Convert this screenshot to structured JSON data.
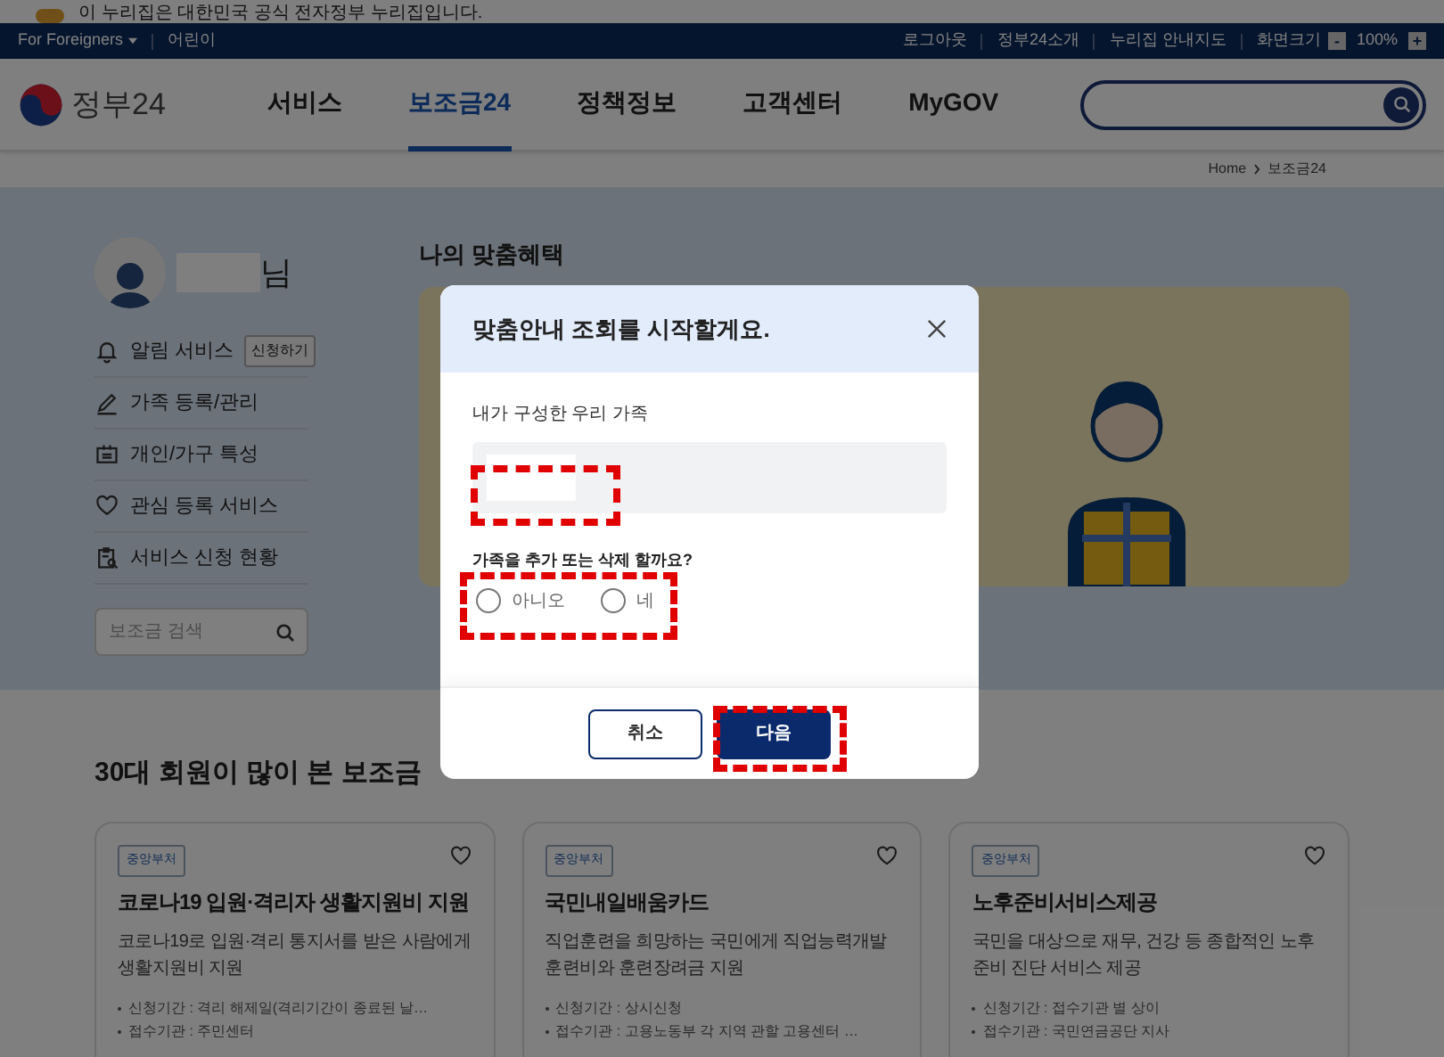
{
  "top_notice": "이 누리집은 대한민국 공식 전자정부 누리집입니다.",
  "utility_bar": {
    "foreigners": "For Foreigners",
    "kids": "어린이",
    "links": [
      "로그아웃",
      "정부24소개",
      "누리집 안내지도"
    ],
    "zoom": {
      "label": "화면크기",
      "decrease": "-",
      "value": "100%",
      "increase": "+"
    }
  },
  "logo": "정부24",
  "nav": [
    {
      "label": "서비스",
      "selected": false
    },
    {
      "label": "보조금24",
      "selected": true
    },
    {
      "label": "정책정보",
      "selected": false
    },
    {
      "label": "고객센터",
      "selected": false
    },
    {
      "label": "MyGOV",
      "selected": false
    }
  ],
  "breadcrumb": [
    "Home",
    "보조금24"
  ],
  "profile": {
    "suffix": "님"
  },
  "side_menu": [
    {
      "label": "알림 서비스",
      "action": "신청하기"
    },
    {
      "label": "가족 등록/관리"
    },
    {
      "label": "개인/가구 특성"
    },
    {
      "label": "관심 등록 서비스"
    },
    {
      "label": "서비스 신청 현황"
    }
  ],
  "subsidy_search": {
    "placeholder": "보조금 검색"
  },
  "benefits_title": "나의 맞춤혜택",
  "popular": {
    "title": "30대 회원이 많이 본 보조금",
    "cards": [
      {
        "tag": "중앙부처",
        "title": "코로나19 입원·격리자 생활지원비 지원",
        "description": "코로나19로 입원·격리 통지서를 받은 사람에게 생활지원비 지원",
        "details": [
          "신청기간 : 격리 해제일(격리기간이 종료된 날…",
          "접수기관 : 주민센터"
        ]
      },
      {
        "tag": "중앙부처",
        "title": "국민내일배움카드",
        "description": "직업훈련을 희망하는 국민에게 직업능력개발훈련비와 훈련장려금 지원",
        "details": [
          "신청기간 : 상시신청",
          "접수기관 : 고용노동부 각 지역 관할 고용센터 …"
        ]
      },
      {
        "tag": "중앙부처",
        "title": "노후준비서비스제공",
        "description": "국민을 대상으로 재무, 건강 등 종합적인 노후준비 진단 서비스 제공",
        "details": [
          "신청기간 : 접수기관 별 상이",
          "접수기관 : 국민연금공단 지사"
        ]
      }
    ]
  },
  "dialog": {
    "title": "맞춤안내 조회를 시작할게요.",
    "family_label": "내가 구성한 우리 가족",
    "question": "가족을 추가 또는 삭제 할까요?",
    "options": [
      {
        "label": "아니오",
        "selected": false
      },
      {
        "label": "네",
        "selected": false
      }
    ],
    "buttons": [
      {
        "label": "취소",
        "kind": "secondary"
      },
      {
        "label": "다음",
        "kind": "primary"
      }
    ]
  }
}
